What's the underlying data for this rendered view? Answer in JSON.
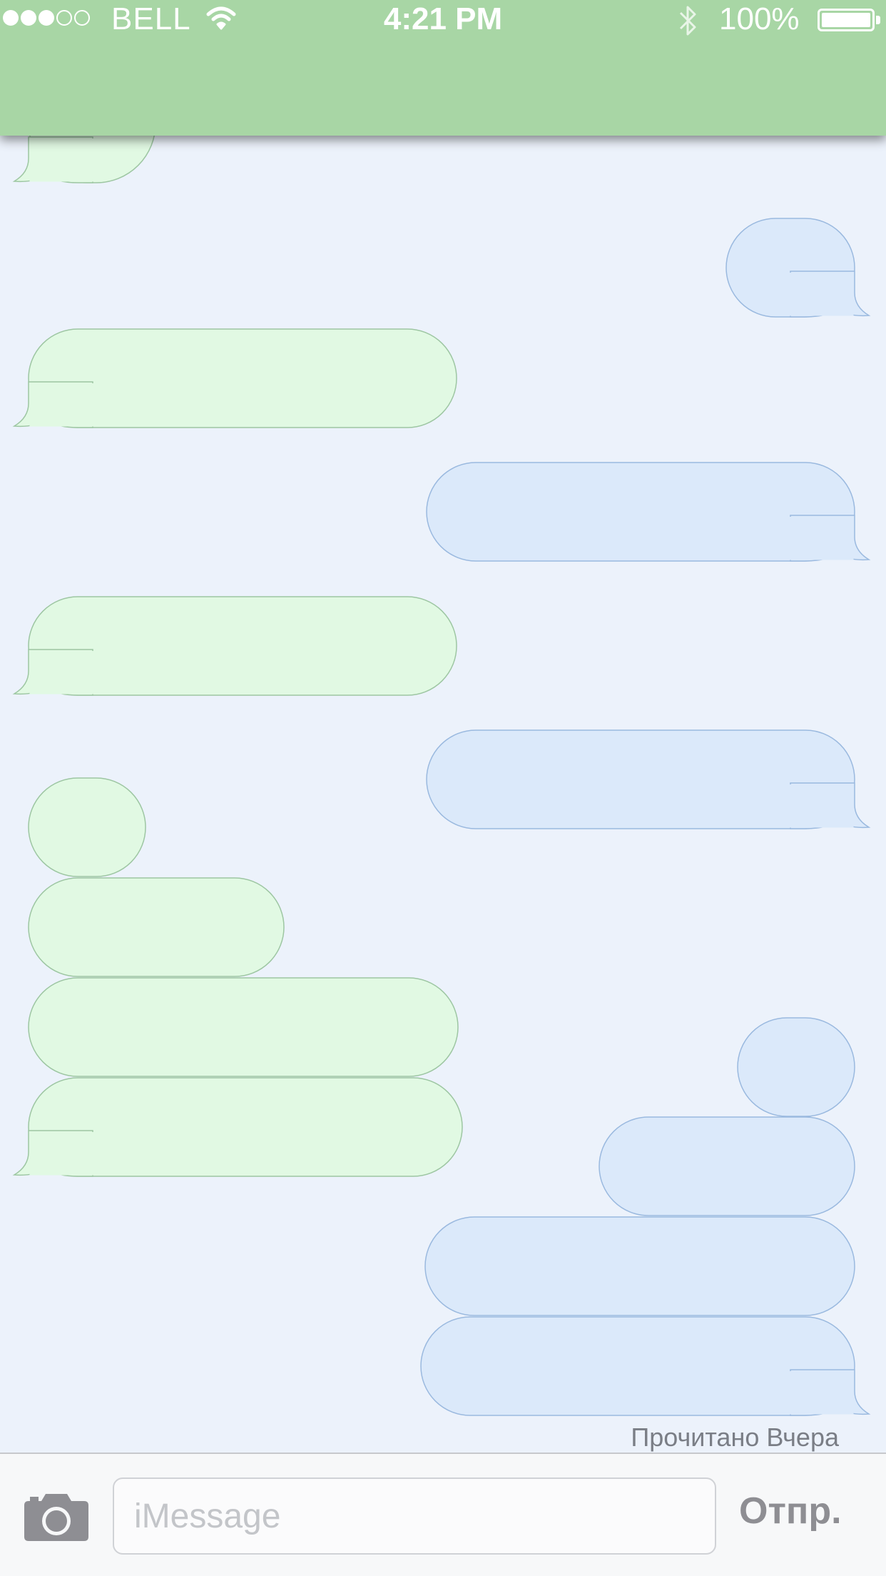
{
  "status_bar": {
    "carrier": "BELL",
    "time": "4:21 PM",
    "battery": "100%",
    "signal_bars_filled": 3,
    "signal_bars_total": 5,
    "icons": [
      "wifi-icon",
      "bluetooth-icon",
      "battery-icon"
    ]
  },
  "header": {
    "color": "#a8d6a5"
  },
  "colors": {
    "thread_background": "#ecf2fb",
    "incoming_fill": "#e1f9e3",
    "incoming_stroke": "#9dc6a2",
    "outgoing_fill": "#dbe9fa",
    "outgoing_stroke": "#9ab9df"
  },
  "thread": {
    "messages": [
      {
        "direction": "incoming",
        "tail": true
      },
      {
        "direction": "outgoing",
        "tail": true
      },
      {
        "direction": "incoming",
        "tail": true
      },
      {
        "direction": "outgoing",
        "tail": true
      },
      {
        "direction": "incoming",
        "tail": true
      },
      {
        "direction": "outgoing",
        "tail": true
      },
      {
        "direction": "incoming",
        "tail": false
      },
      {
        "direction": "incoming",
        "tail": false
      },
      {
        "direction": "incoming",
        "tail": false
      },
      {
        "direction": "incoming",
        "tail": true
      },
      {
        "direction": "outgoing",
        "tail": false
      },
      {
        "direction": "outgoing",
        "tail": false
      },
      {
        "direction": "outgoing",
        "tail": false
      },
      {
        "direction": "outgoing",
        "tail": true
      }
    ],
    "read_receipt": "Прочитано Вчера"
  },
  "composer": {
    "placeholder": "iMessage",
    "send_label": "Отпр.",
    "camera_icon": "camera-icon"
  }
}
